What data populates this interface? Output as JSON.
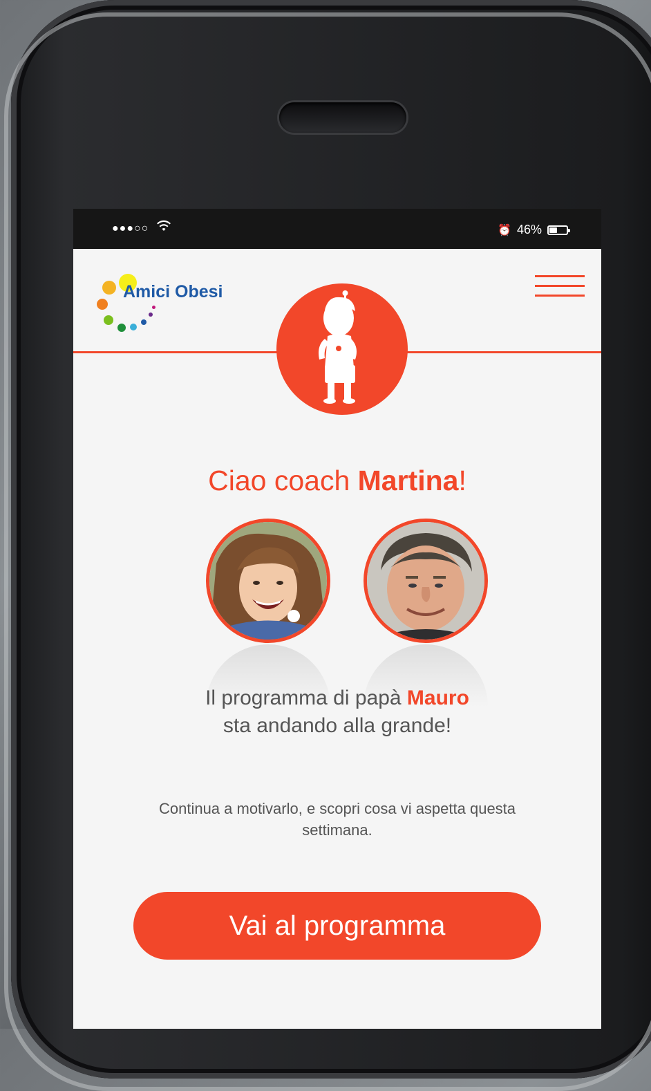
{
  "status_bar": {
    "signal": "●●●○○",
    "battery_percent": "46%",
    "battery_level": 0.46
  },
  "header": {
    "logo_text": "Amici Obesi",
    "menu_icon": "hamburger-icon",
    "avatar_icon": "child-silhouette-icon"
  },
  "main": {
    "greeting_prefix": "Ciao coach ",
    "greeting_name": "Martina",
    "greeting_suffix": "!",
    "program_line1_prefix": "Il programma di papà ",
    "program_line1_name": "Mauro",
    "program_line2": "sta andando alla grande!",
    "sub_text": "Continua a motivarlo, e scopri cosa vi aspetta questa settimana.",
    "cta_label": "Vai al programma"
  },
  "colors": {
    "accent": "#f2472a",
    "logo_blue": "#1f5aa6",
    "background": "#f5f5f5"
  }
}
